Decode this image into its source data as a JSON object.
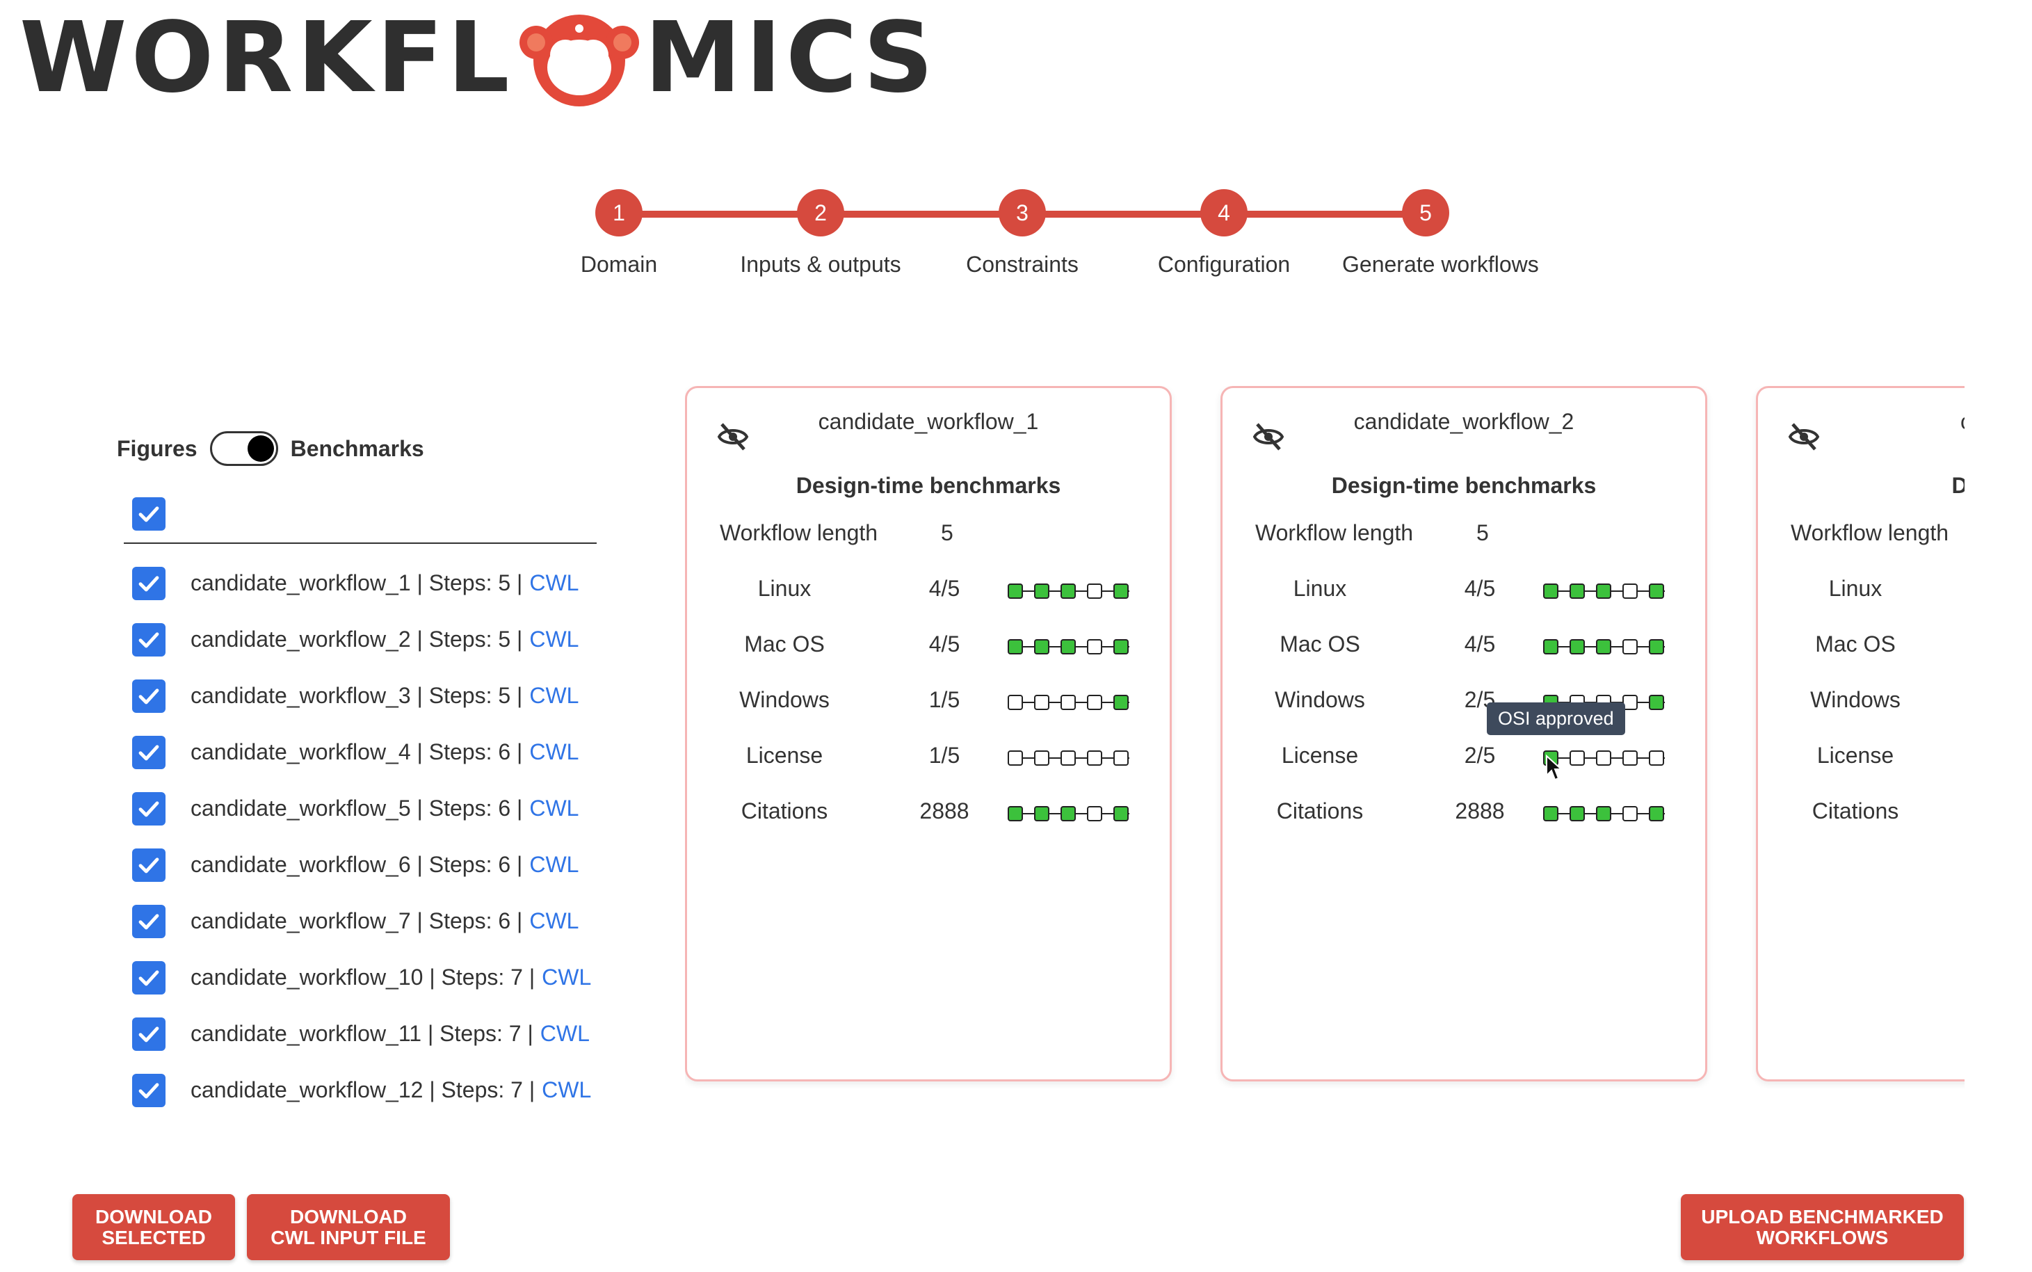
{
  "app": {
    "logo_text_left": "WORKFL",
    "logo_text_right": "MICS"
  },
  "stepper": [
    {
      "num": "1",
      "label": "Domain"
    },
    {
      "num": "2",
      "label": "Inputs & outputs"
    },
    {
      "num": "3",
      "label": "Constraints"
    },
    {
      "num": "4",
      "label": "Configuration"
    },
    {
      "num": "5",
      "label": "Generate workflows"
    }
  ],
  "view_toggle": {
    "left_label": "Figures",
    "right_label": "Benchmarks",
    "active": "Benchmarks"
  },
  "workflows": [
    {
      "label": "candidate_workflow_1 | Steps: 5 |",
      "link": "CWL"
    },
    {
      "label": "candidate_workflow_2 | Steps: 5 |",
      "link": "CWL"
    },
    {
      "label": "candidate_workflow_3 | Steps: 5 |",
      "link": "CWL"
    },
    {
      "label": "candidate_workflow_4 | Steps: 6 |",
      "link": "CWL"
    },
    {
      "label": "candidate_workflow_5 | Steps: 6 |",
      "link": "CWL"
    },
    {
      "label": "candidate_workflow_6 | Steps: 6 |",
      "link": "CWL"
    },
    {
      "label": "candidate_workflow_7 | Steps: 6 |",
      "link": "CWL"
    },
    {
      "label": "candidate_workflow_10 | Steps: 7 |",
      "link": "CWL"
    },
    {
      "label": "candidate_workflow_11 | Steps: 7 |",
      "link": "CWL"
    },
    {
      "label": "candidate_workflow_12 | Steps: 7 |",
      "link": "CWL"
    }
  ],
  "cards": [
    {
      "title": "candidate_workflow_1",
      "subtitle": "Design-time benchmarks",
      "length_label": "Workflow length",
      "length_value": "5",
      "rows": [
        {
          "name": "Linux",
          "value": "4/5",
          "dots": [
            1,
            1,
            1,
            0,
            1
          ]
        },
        {
          "name": "Mac OS",
          "value": "4/5",
          "dots": [
            1,
            1,
            1,
            0,
            1
          ]
        },
        {
          "name": "Windows",
          "value": "1/5",
          "dots": [
            0,
            0,
            0,
            0,
            1
          ]
        },
        {
          "name": "License",
          "value": "1/5",
          "dots": [
            0,
            0,
            0,
            0,
            0
          ]
        },
        {
          "name": "Citations",
          "value": "2888",
          "dots": [
            1,
            1,
            1,
            0,
            1
          ]
        }
      ]
    },
    {
      "title": "candidate_workflow_2",
      "subtitle": "Design-time benchmarks",
      "length_label": "Workflow length",
      "length_value": "5",
      "rows": [
        {
          "name": "Linux",
          "value": "4/5",
          "dots": [
            1,
            1,
            1,
            0,
            1
          ]
        },
        {
          "name": "Mac OS",
          "value": "4/5",
          "dots": [
            1,
            1,
            1,
            0,
            1
          ]
        },
        {
          "name": "Windows",
          "value": "2/5",
          "dots": [
            1,
            0,
            0,
            0,
            1
          ]
        },
        {
          "name": "License",
          "value": "2/5",
          "dots": [
            1,
            0,
            0,
            0,
            0
          ]
        },
        {
          "name": "Citations",
          "value": "2888",
          "dots": [
            1,
            1,
            1,
            0,
            1
          ]
        }
      ]
    },
    {
      "title": "candida",
      "subtitle": "Design-ti",
      "length_label": "Workflow length",
      "length_value": "",
      "rows": [
        {
          "name": "Linux",
          "value": "",
          "dots": []
        },
        {
          "name": "Mac OS",
          "value": "",
          "dots": []
        },
        {
          "name": "Windows",
          "value": "",
          "dots": []
        },
        {
          "name": "License",
          "value": "",
          "dots": []
        },
        {
          "name": "Citations",
          "value": "",
          "dots": []
        }
      ]
    }
  ],
  "tooltip": {
    "text": "OSI approved"
  },
  "buttons": {
    "download_selected": "DOWNLOAD SELECTED",
    "download_cwl_input": "DOWNLOAD CWL INPUT FILE",
    "upload_benchmarked": "UPLOAD BENCHMARKED WORKFLOWS"
  },
  "colors": {
    "accent": "#d64a3e",
    "checkbox": "#2f74e6",
    "dot_on": "#3cc13c",
    "card_border": "#f6b5b5"
  }
}
